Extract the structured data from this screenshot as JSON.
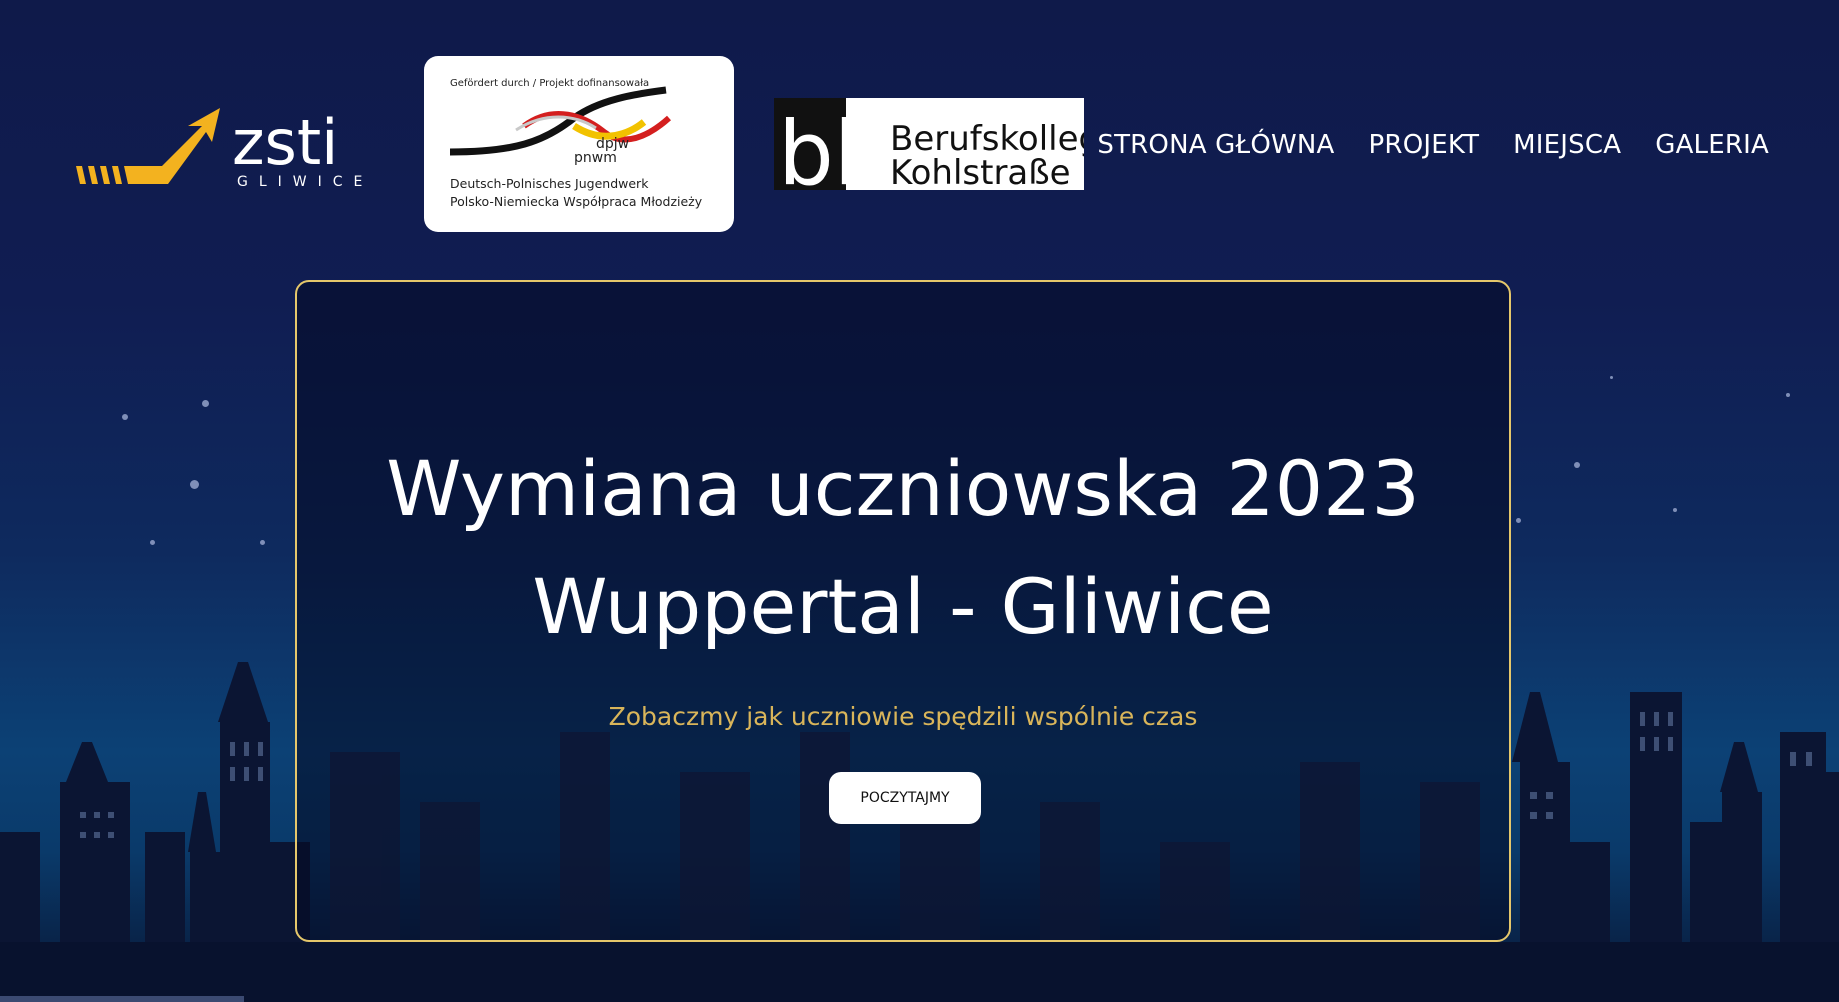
{
  "header": {
    "logo_zsti": {
      "name": "zsti",
      "sub": "GLIWICE"
    },
    "logo_dpjw": {
      "top_line": "Gefördert durch / Projekt dofinansowała",
      "mark_1": "dpjw",
      "mark_2": "pnwm",
      "line_1": "Deutsch-Polnisches Jugendwerk",
      "line_2": "Polsko-Niemiecka Współpraca Młodzieży"
    },
    "logo_bk": {
      "mark": "bk",
      "line_1": "Berufskolleg",
      "line_2": "Kohlstraße"
    },
    "nav": [
      "STRONA GŁÓWNA",
      "PROJEKT",
      "MIEJSCA",
      "GALERIA"
    ]
  },
  "hero": {
    "title_line_1": "Wymiana uczniowska 2023",
    "title_line_2": "Wuppertal - Gliwice",
    "subtitle": "Zobaczmy jak uczniowie spędzili wspólnie czas",
    "cta": "POCZYTAJMY"
  },
  "colors": {
    "accent_gold": "#e5c76b",
    "subtitle": "#d9b55a",
    "zsti_arrow": "#f3b21f",
    "background_top": "#0f1a4a"
  }
}
